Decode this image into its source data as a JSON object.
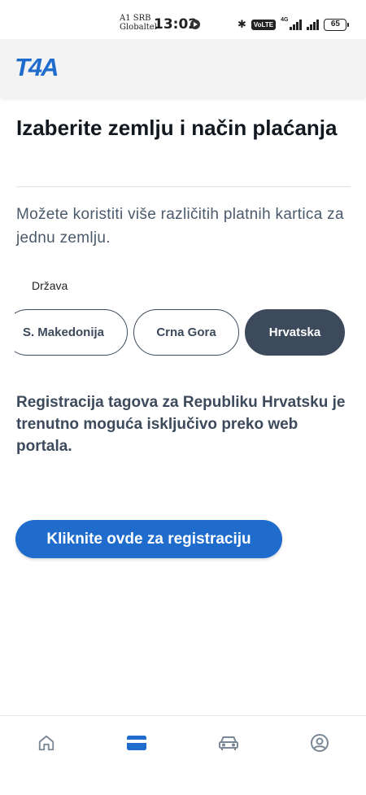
{
  "status_bar": {
    "carrier_line1": "A1 SRB",
    "carrier_line2": "Globaltel",
    "time": "13:02",
    "volte_label": "VoLTE",
    "network_label": "4G",
    "battery": "65"
  },
  "header": {
    "logo_text": "T4A"
  },
  "page": {
    "title": "Izaberite zemlju i način plaćanja",
    "subtitle": "Možete koristiti više različitih platnih kartica za jednu zemlju.",
    "country_label": "Država",
    "countries": [
      {
        "label": "S. Makedonija",
        "selected": false
      },
      {
        "label": "Crna Gora",
        "selected": false
      },
      {
        "label": "Hrvatska",
        "selected": true
      }
    ],
    "notice": "Registracija tagova za Republiku Hrvatsku je trenutno moguća isključivo preko web portala.",
    "cta_label": "Kliknite ovde za registraciju"
  },
  "bottom_nav": {
    "items": [
      {
        "icon": "home-icon",
        "active": false
      },
      {
        "icon": "card-icon",
        "active": true
      },
      {
        "icon": "car-icon",
        "active": false
      },
      {
        "icon": "profile-icon",
        "active": false
      }
    ]
  },
  "colors": {
    "brand_blue": "#1f6ccd",
    "slate": "#3c4a5c",
    "nav_inactive": "#7a8796"
  }
}
